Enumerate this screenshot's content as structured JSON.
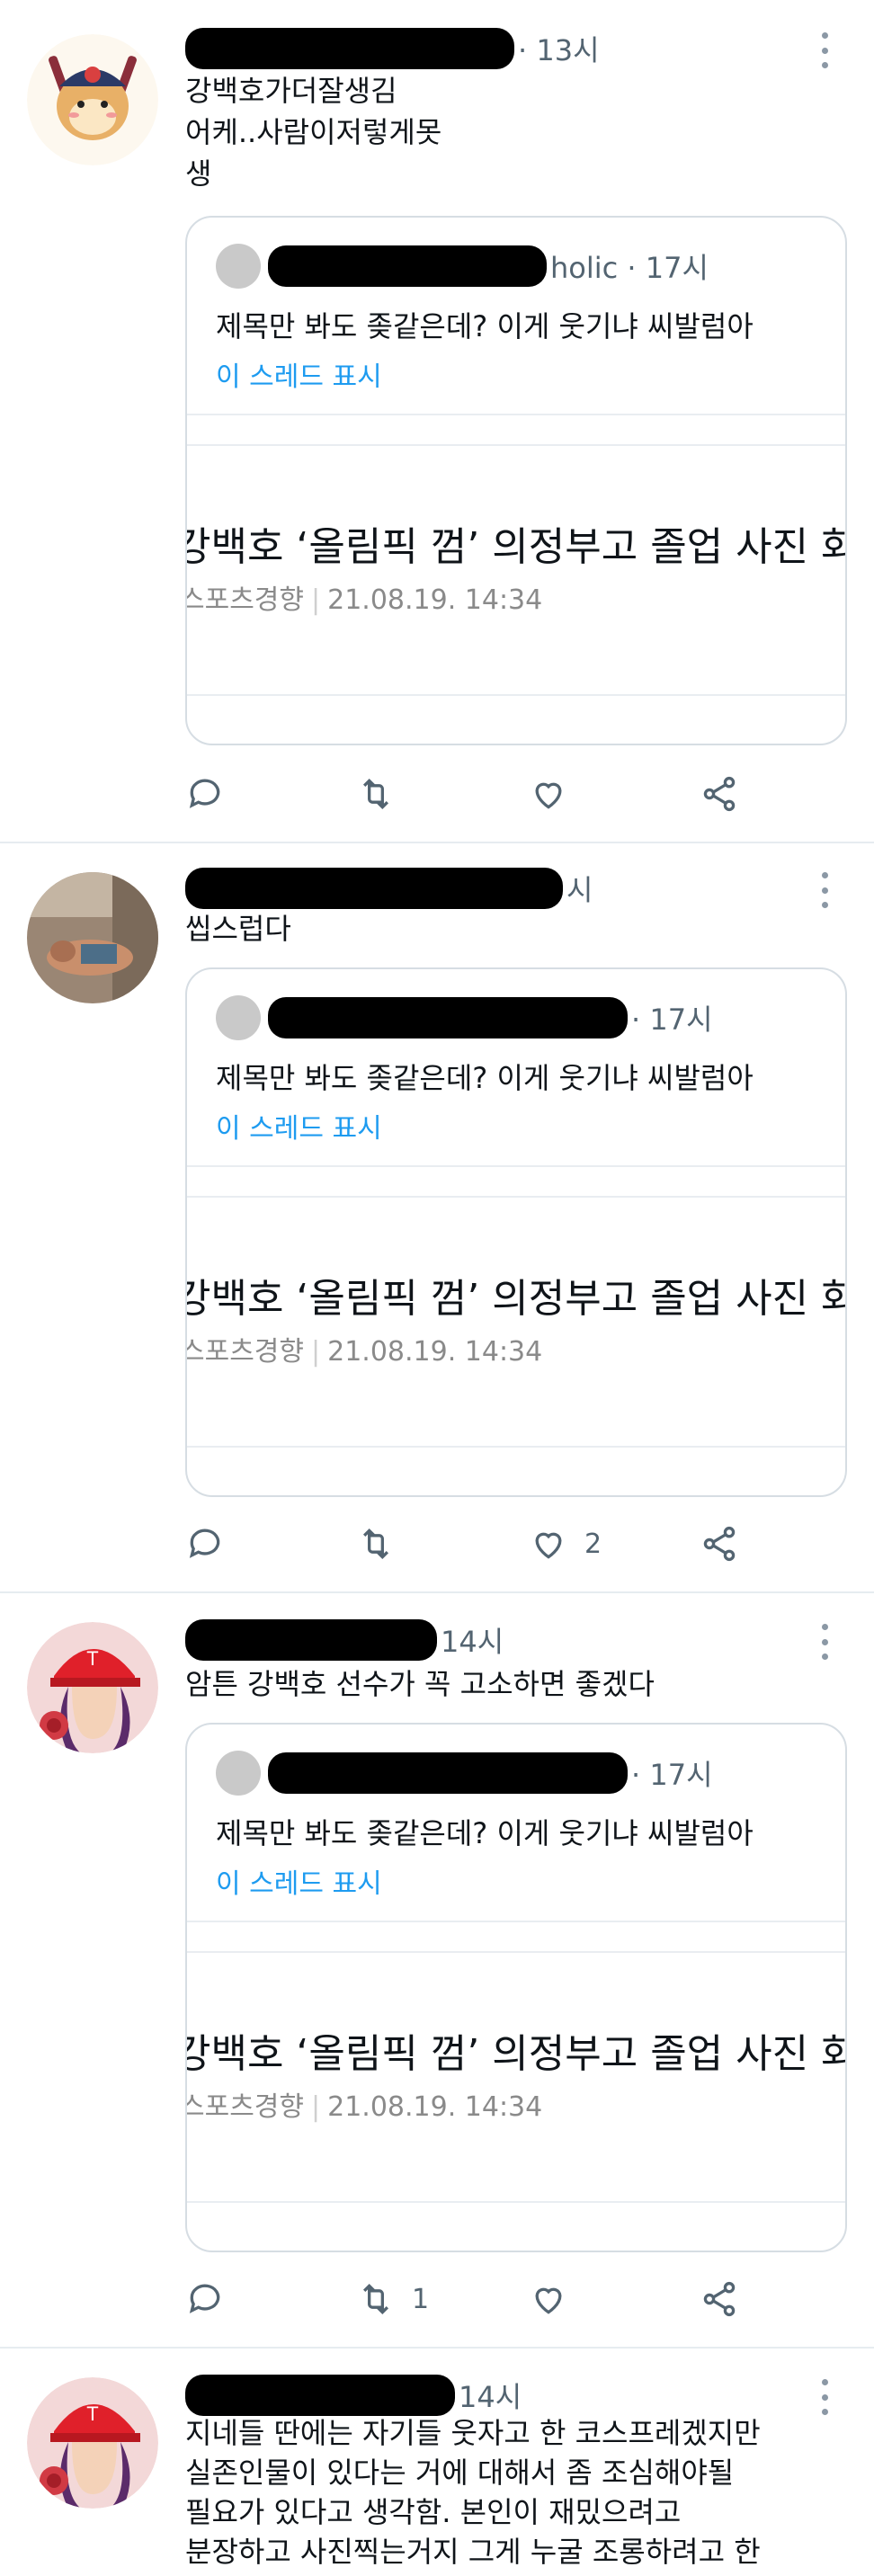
{
  "tweets": [
    {
      "header_suffix": "· 13시",
      "text": "강백호가더잘생김\n어케..사람이저렇게못\n생",
      "quote": {
        "header_suffix": "holic · 17시",
        "text": "제목만 봐도 좆같은데? 이게 웃기냐 씨발럼아",
        "thread_link": "이 스레드 표시"
      },
      "card": {
        "title": "강백호 ‘올림픽 껌’ 의정부고 졸업 사진 화",
        "source": "스포츠경향",
        "date": "21.08.19. 14:34"
      },
      "counts": {
        "reply": "",
        "retweet": "",
        "like": ""
      }
    },
    {
      "header_suffix": "시",
      "text": "씹스럽다",
      "quote": {
        "header_suffix": "· 17시",
        "text": "제목만 봐도 좆같은데? 이게 웃기냐 씨발럼아",
        "thread_link": "이 스레드 표시"
      },
      "card": {
        "title": "강백호 ‘올림픽 껌’ 의정부고 졸업 사진 화",
        "source": "스포츠경향",
        "date": "21.08.19. 14:34"
      },
      "counts": {
        "reply": "",
        "retweet": "",
        "like": "2"
      }
    },
    {
      "header_suffix": "14시",
      "text": "암튼 강백호 선수가 꼭 고소하면 좋겠다",
      "quote": {
        "header_suffix": "· 17시",
        "text": "제목만 봐도 좆같은데? 이게 웃기냐 씨발럼아",
        "thread_link": "이 스레드 표시"
      },
      "card": {
        "title": "강백호 ‘올림픽 껌’ 의정부고 졸업 사진 화",
        "source": "스포츠경향",
        "date": "21.08.19. 14:34"
      },
      "counts": {
        "reply": "",
        "retweet": "1",
        "like": ""
      }
    },
    {
      "header_suffix": "14시",
      "text": "지네들 딴에는 자기들 웃자고 한 코스프레겠지만\n실존인물이 있다는 거에 대해서 좀 조심해야될\n필요가 있다고 생각함. 본인이 재밌으려고\n분장하고 사진찍는거지 그게 누굴 조롱하려고 한"
    }
  ],
  "icons": [
    "more-icon",
    "reply-icon",
    "retweet-icon",
    "like-icon",
    "share-icon"
  ],
  "colors": {
    "link": "#1d9bf0",
    "secondary": "#536471",
    "border": "#d6dde3"
  }
}
